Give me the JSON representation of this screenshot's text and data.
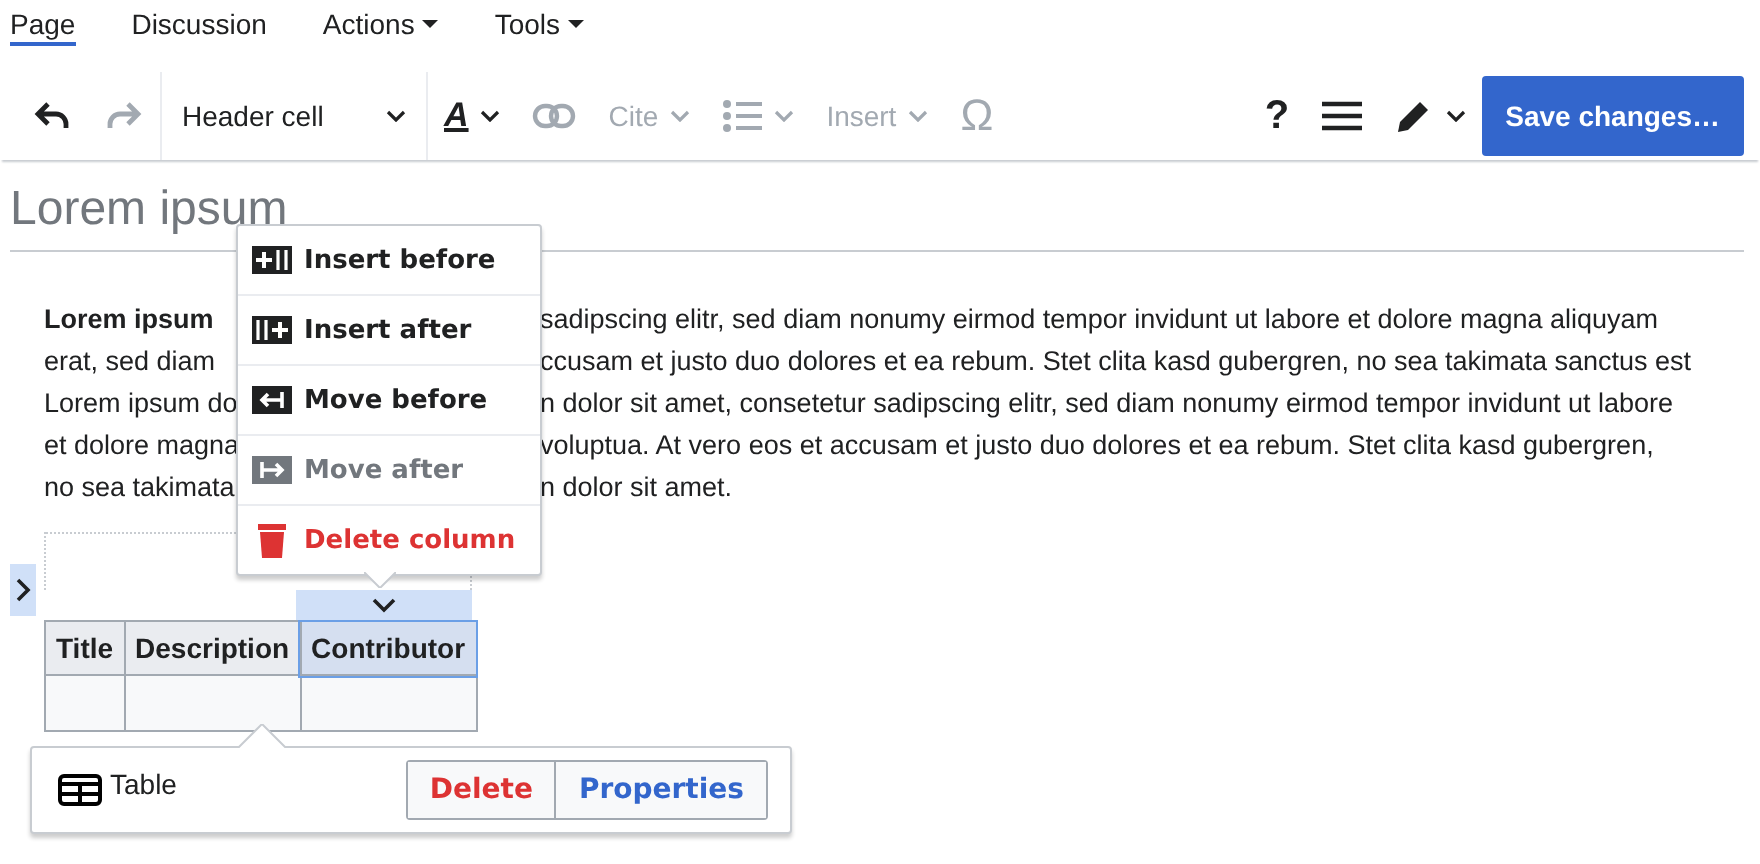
{
  "tabs": [
    {
      "label": "Page",
      "kind": "tab",
      "selected": true
    },
    {
      "label": "Discussion",
      "kind": "tab",
      "selected": false
    },
    {
      "label": "Actions",
      "kind": "menu",
      "selected": false
    },
    {
      "label": "Tools",
      "kind": "menu",
      "selected": false
    }
  ],
  "toolbar": {
    "items": [
      {
        "kind": "undo",
        "disabled": false
      },
      {
        "kind": "redo",
        "disabled": true
      },
      {
        "kind": "format",
        "label": "Header cell",
        "disabled": false
      },
      {
        "kind": "style",
        "label": "A",
        "disabled": false
      },
      {
        "kind": "link",
        "disabled": true
      },
      {
        "kind": "cite",
        "label": "Cite",
        "disabled": true
      },
      {
        "kind": "list",
        "disabled": true
      },
      {
        "kind": "insert",
        "label": "Insert",
        "disabled": true
      },
      {
        "kind": "special",
        "label": "Ω",
        "disabled": true
      }
    ],
    "help": "?",
    "save": "Save changes…"
  },
  "heading": "Lorem ipsum",
  "paragraph": [
    {
      "left": "**Lorem ipsum**",
      "right": "sadipscing elitr, sed diam nonumy eirmod tempor invidunt ut labore et dolore magna aliquyam"
    },
    {
      "left": "erat, sed diam",
      "right": "ccusam et justo duo dolores et ea rebum. Stet clita kasd gubergren, no sea takimata sanctus est"
    },
    {
      "left": "Lorem ipsum do",
      "right": "n dolor sit amet, consetetur sadipscing elitr, sed diam nonumy eirmod tempor invidunt ut labore"
    },
    {
      "left": "et dolore magna",
      "right": "voluptua. At vero eos et accusam et justo duo dolores et ea rebum. Stet clita kasd gubergren,"
    },
    {
      "left": "no sea takimata",
      "right": "n dolor sit amet."
    }
  ],
  "column_menu": [
    {
      "kind": "insert_before",
      "label": "Insert before",
      "disabled": false,
      "danger": false
    },
    {
      "kind": "insert_after",
      "label": "Insert after",
      "disabled": false,
      "danger": false
    },
    {
      "kind": "move_before",
      "label": "Move before",
      "disabled": false,
      "danger": false
    },
    {
      "kind": "move_after",
      "label": "Move after",
      "disabled": true,
      "danger": false
    },
    {
      "kind": "delete",
      "label": "Delete column",
      "disabled": false,
      "danger": true
    }
  ],
  "table": {
    "columns": [
      {
        "label": "Title",
        "selected": false
      },
      {
        "label": "Description",
        "selected": false
      },
      {
        "label": "Contributor",
        "selected": true
      }
    ]
  },
  "context": {
    "label": "Table",
    "actions": [
      {
        "label": "Delete",
        "kind": "destructive"
      },
      {
        "label": "Properties",
        "kind": "progressive"
      }
    ]
  }
}
